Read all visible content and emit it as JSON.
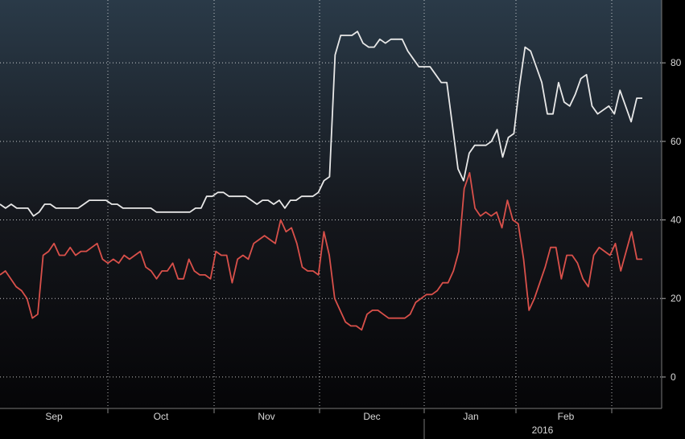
{
  "chart_data": {
    "type": "line",
    "title": "",
    "xlabel": "",
    "ylabel": "",
    "ylim": [
      -8,
      96
    ],
    "yticks": [
      0,
      20,
      40,
      60,
      80
    ],
    "grid": true,
    "months": [
      "Sep",
      "Oct",
      "Nov",
      "Dec",
      "Jan",
      "Feb"
    ],
    "year_label": "2016",
    "colors": {
      "white_series": "#e8e8e8",
      "red_series": "#d9504a",
      "grid": "#ffffff",
      "axis_text": "#d8d8d8"
    },
    "series": [
      {
        "values": [
          44,
          43,
          44,
          43,
          43,
          43,
          41,
          42,
          44,
          44,
          43,
          43,
          43,
          43,
          43,
          44,
          45,
          45,
          45,
          45,
          44,
          44,
          43,
          43,
          43,
          43,
          43,
          43,
          42,
          42,
          42,
          42,
          42,
          42,
          42,
          43,
          43,
          46,
          46,
          47,
          47,
          46,
          46,
          46,
          46,
          45,
          44,
          45,
          45,
          44,
          45,
          43,
          45,
          45,
          46,
          46,
          46,
          47,
          50,
          51,
          82,
          87,
          87,
          87,
          88,
          85,
          84,
          84,
          86,
          85,
          86,
          86,
          86,
          83,
          81,
          79,
          79,
          79,
          77,
          75,
          75,
          64,
          53,
          50,
          57,
          59,
          59,
          59,
          60,
          63,
          56,
          61,
          62,
          74,
          84,
          83,
          79,
          75,
          67,
          67,
          75,
          70,
          69,
          72,
          76,
          77,
          69,
          67,
          68,
          69,
          67,
          73,
          69,
          65,
          71,
          71
        ]
      },
      {
        "values": [
          26,
          27,
          25,
          23,
          22,
          20,
          15,
          16,
          31,
          32,
          34,
          31,
          31,
          33,
          31,
          32,
          32,
          33,
          34,
          30,
          29,
          30,
          29,
          31,
          30,
          31,
          32,
          28,
          27,
          25,
          27,
          27,
          29,
          25,
          25,
          30,
          27,
          26,
          26,
          25,
          32,
          31,
          31,
          24,
          30,
          31,
          30,
          34,
          35,
          36,
          35,
          34,
          40,
          37,
          38,
          34,
          28,
          27,
          27,
          26,
          37,
          31,
          20,
          17,
          14,
          13,
          13,
          12,
          16,
          17,
          17,
          16,
          15,
          15,
          15,
          15,
          16,
          19,
          20,
          21,
          21,
          22,
          24,
          24,
          27,
          32,
          48,
          52,
          43,
          41,
          42,
          41,
          42,
          38,
          45,
          40,
          39,
          30,
          17,
          20,
          24,
          28,
          33,
          33,
          25,
          31,
          31,
          29,
          25,
          23,
          31,
          33,
          32,
          31,
          34,
          27,
          32,
          37,
          30,
          30
        ]
      }
    ]
  }
}
